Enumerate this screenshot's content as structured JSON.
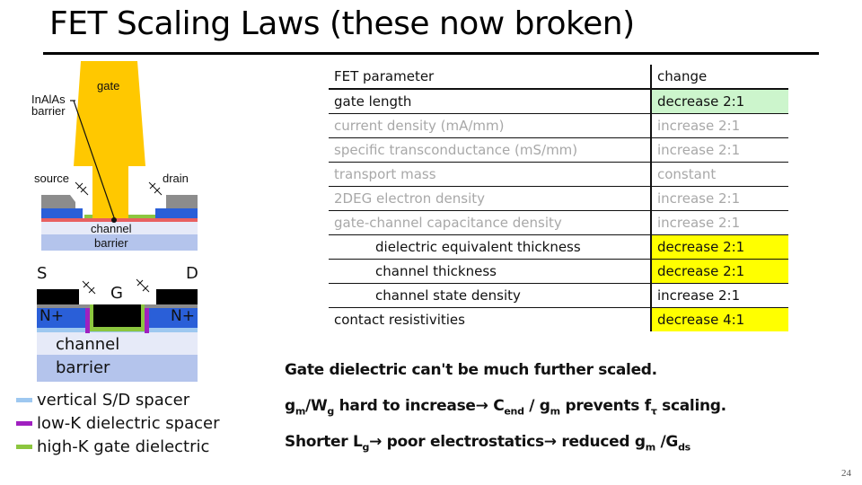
{
  "slide": {
    "title": "FET Scaling Laws (these now broken)",
    "page_number": "24"
  },
  "diagram_top": {
    "labels": {
      "gate": "gate",
      "barrier_line1": "InAlAs",
      "barrier_line2": "barrier",
      "source": "source",
      "drain": "drain",
      "channel": "channel",
      "barrier": "barrier"
    },
    "colors": {
      "gate": "#ffc800",
      "contact": "#8c8c8c",
      "n_plus": "#2a5fd8",
      "interface": "#e86060",
      "high_k": "#8cc63f",
      "channel": "#e6eaf8",
      "barrier": "#b4c4ec"
    }
  },
  "diagram_bottom": {
    "labels": {
      "source": "S",
      "drain": "D",
      "gate": "G",
      "n_plus_left": "N+",
      "n_plus_right": "N+",
      "channel": "channel",
      "barrier": "barrier"
    },
    "colors": {
      "metal": "#000000",
      "n_plus": "#2a5fd8",
      "vertical_spacer": "#9ec8f0",
      "low_k": "#a020c0",
      "high_k": "#8cc63f",
      "channel": "#e6eaf8",
      "barrier": "#b4c4ec"
    }
  },
  "legend": [
    {
      "label": "vertical S/D spacer",
      "color": "#9ec8f0"
    },
    {
      "label": "low-K dielectric spacer",
      "color": "#a020c0"
    },
    {
      "label": "high-K gate dielectric",
      "color": "#8cc63f"
    }
  ],
  "table": {
    "header": {
      "param": "FET parameter",
      "change": "change"
    },
    "rows": [
      {
        "param": "gate length",
        "change": "decrease 2:1",
        "style": "black",
        "highlight": "green",
        "indent": false
      },
      {
        "param": "current density (mA/mm)",
        "change": "increase  2:1",
        "style": "gray",
        "highlight": "",
        "indent": false
      },
      {
        "param": "specific transconductance (mS/mm)",
        "change": "increase 2:1",
        "style": "gray",
        "highlight": "",
        "indent": false
      },
      {
        "param": "transport mass",
        "change": "constant",
        "style": "gray",
        "highlight": "",
        "indent": false
      },
      {
        "param": "2DEG  electron density",
        "change": "increase  2:1",
        "style": "gray",
        "highlight": "",
        "indent": false
      },
      {
        "param": "gate-channel capacitance density",
        "change": "increase  2:1",
        "style": "gray",
        "highlight": "",
        "indent": false
      },
      {
        "param": "dielectric equivalent thickness",
        "change": "decrease 2:1",
        "style": "black",
        "highlight": "yellow",
        "indent": true
      },
      {
        "param": "channel thickness",
        "change": "decrease 2:1",
        "style": "black",
        "highlight": "yellow",
        "indent": true
      },
      {
        "param": "channel state density",
        "change": "increase  2:1",
        "style": "black",
        "highlight": "",
        "indent": true
      },
      {
        "param": "contact resistivities",
        "change": "decrease 4:1",
        "style": "black",
        "highlight": "yellow",
        "indent": false
      }
    ]
  },
  "notes": {
    "line1": "Gate dielectric can't be much further scaled.",
    "line2": {
      "g": "g",
      "m1": "m",
      "slash_w": "/W",
      "g_sub": "g",
      "mid": " hard to increase→ C",
      "end_sub": "end",
      "slash_g": " / g",
      "m2": "m",
      "prevents": " prevents f",
      "tau": "τ",
      "tail": " scaling."
    },
    "line3": {
      "start": "Shorter L",
      "g_sub": "g",
      "mid": "→ poor electrostatics→ reduced g",
      "m": "m",
      "slash": " /G",
      "ds": "ds"
    }
  }
}
